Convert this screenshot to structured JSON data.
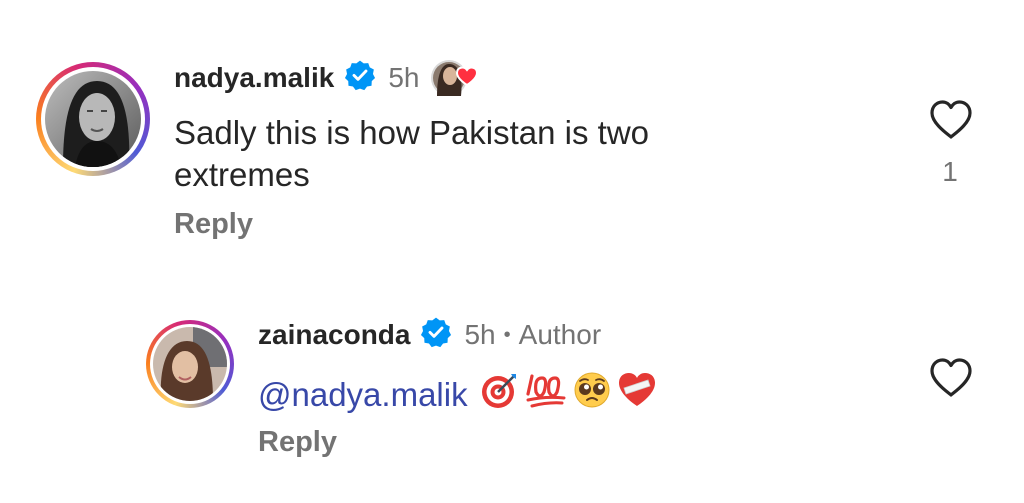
{
  "comments": [
    {
      "username": "nadya.malik",
      "time": "5h",
      "text": "Sadly this is how Pakistan is two extremes",
      "reply_label": "Reply",
      "like_count": "1",
      "verified": true
    }
  ],
  "reply": {
    "username": "zainaconda",
    "time": "5h",
    "separator": "•",
    "author_label": "Author",
    "mention": "@nadya.malik",
    "reply_label": "Reply",
    "verified": true,
    "emojis": [
      "direct-hit-emoji",
      "hundred-points-emoji",
      "pleading-face-emoji",
      "mending-heart-emoji"
    ]
  },
  "colors": {
    "verified_blue": "#0095f6",
    "mention_blue": "#3848a8",
    "heart_red": "#ff3040",
    "muted_text": "#737373"
  }
}
